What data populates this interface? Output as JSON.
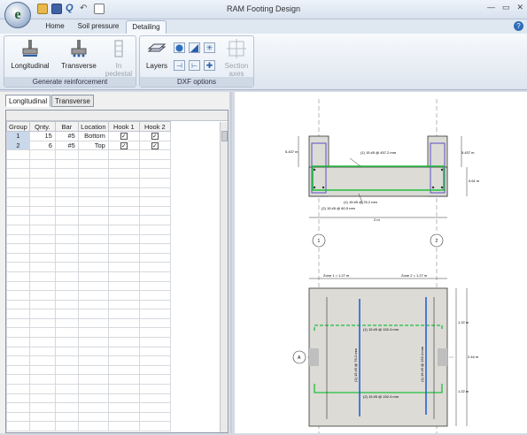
{
  "window": {
    "title": "RAM Footing Design",
    "app_letter": "e"
  },
  "quick_access": [
    "open-icon",
    "save-icon",
    "query-icon",
    "undo-icon",
    "report-icon"
  ],
  "tabs": [
    "Home",
    "Soil pressure",
    "Detailing"
  ],
  "active_tab": "Detailing",
  "ribbon": {
    "groups": {
      "generate": "Generate reinforcement",
      "dxf": "DXF options"
    },
    "buttons": {
      "longitudinal": "Longitudinal",
      "transverse": "Transverse",
      "in_pedestal_1": "In",
      "in_pedestal_2": "pedestal",
      "layers": "Layers",
      "section_axes_1": "Section",
      "section_axes_2": "axes"
    }
  },
  "left_tabs": [
    "Longitudinal",
    "Transverse"
  ],
  "table": {
    "headers": [
      "Group",
      "Qnty.",
      "Bar",
      "Location",
      "Hook 1",
      "Hook 2"
    ],
    "rows": [
      {
        "group": "1",
        "qnty": "15",
        "bar": "#5",
        "location": "Bottom",
        "hook1": "✓",
        "hook2": "✓"
      },
      {
        "group": "2",
        "qnty": "6",
        "bar": "#5",
        "location": "Top",
        "hook1": "✓",
        "hook2": "✓"
      }
    ]
  },
  "drawing": {
    "section": {
      "callout_top": "(1) 15 #5 @ 457.2 mm",
      "callout_bot1": "(1) 15 #5 @ 76.2 mm",
      "callout_bot2": "(2) 15 #5 @ 60.5 mm",
      "dim_left": "5.437 m",
      "dim_right1": "5.437 m",
      "dim_right2": "0.61 m",
      "dim_bottom": "2 m"
    },
    "plan": {
      "grid_1": "1",
      "grid_2": "2",
      "grid_a": "A",
      "zone_1": "Zone 1 = 1.27 m",
      "zone_2": "Zone 2 = 1.27 m",
      "dim_r1": "1.22 m",
      "dim_r2": "2.44 m",
      "dim_r3": "1.22 m",
      "bar_top": "(1) 15 #5 @ 152.4 mm",
      "bar_bot": "(2) 15 #5 @ 152.4 mm",
      "bar_v1": "(2) 15 #5 @ 76.2 mm",
      "bar_v2": "(1) 15 #5 @ 152.4 mm"
    }
  }
}
